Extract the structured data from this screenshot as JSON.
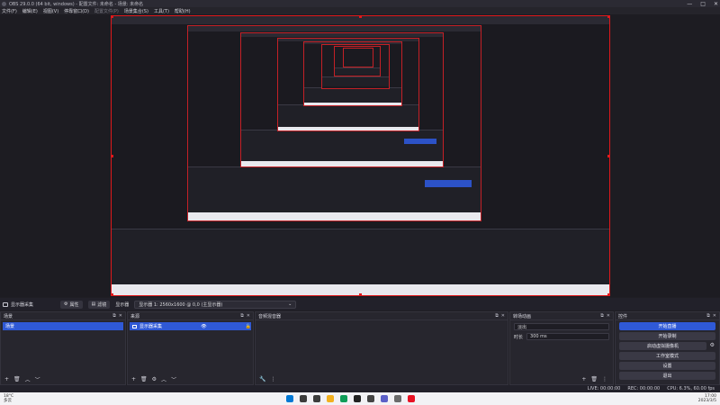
{
  "window": {
    "title": "OBS 29.0.0 (64 bit, windows) - 配置文件: 未命名 - 场景: 未命名",
    "controls": [
      "—",
      "□",
      "✕"
    ]
  },
  "menu": [
    {
      "label": "文件(F)",
      "enabled": true
    },
    {
      "label": "编辑(E)",
      "enabled": true
    },
    {
      "label": "视图(V)",
      "enabled": true
    },
    {
      "label": "停靠窗口(D)",
      "enabled": true
    },
    {
      "label": "配置文件(P)",
      "enabled": false
    },
    {
      "label": "场景集合(S)",
      "enabled": true
    },
    {
      "label": "工具(T)",
      "enabled": true
    },
    {
      "label": "帮助(H)",
      "enabled": true
    }
  ],
  "controls_bar": {
    "source_name": "显示器采集",
    "properties": "属性",
    "filters": "滤镜",
    "display_label": "显示器",
    "display_value": "显示器 1: 2560x1600 @ 0,0 (主显示器)"
  },
  "scenes": {
    "title": "场景",
    "items": [
      "场景"
    ]
  },
  "sources": {
    "title": "来源",
    "items": [
      {
        "name": "显示器采集"
      }
    ]
  },
  "audio_mixer": {
    "title": "音频混音器"
  },
  "transitions": {
    "title": "转场动画",
    "type": "淡出",
    "duration_label": "时长",
    "duration_value": "300 ms"
  },
  "controls": {
    "title": "控件",
    "buttons": [
      "开始直播",
      "开始录制",
      "启动虚拟摄像机",
      "工作室模式",
      "设置",
      "退出"
    ]
  },
  "status": {
    "live": "LIVE: 00:00:00",
    "rec": "REC: 00:00:00",
    "cpu": "CPU: 6.3%, 60.00 fps"
  },
  "taskbar": {
    "weather_temp": "18°C",
    "weather_desc": "多云",
    "time": "17:00",
    "date": "2023/3/5",
    "app_colors": [
      "#1a73e8",
      "#0078d4",
      "#3c3c3c",
      "#f2b01e",
      "#0f9d58",
      "#222222",
      "#444444",
      "#5b5fc7",
      "#e81123",
      "#6b6b6b"
    ]
  },
  "colors": {
    "accent": "#2f59d6",
    "selection_border": "#e0181b"
  }
}
